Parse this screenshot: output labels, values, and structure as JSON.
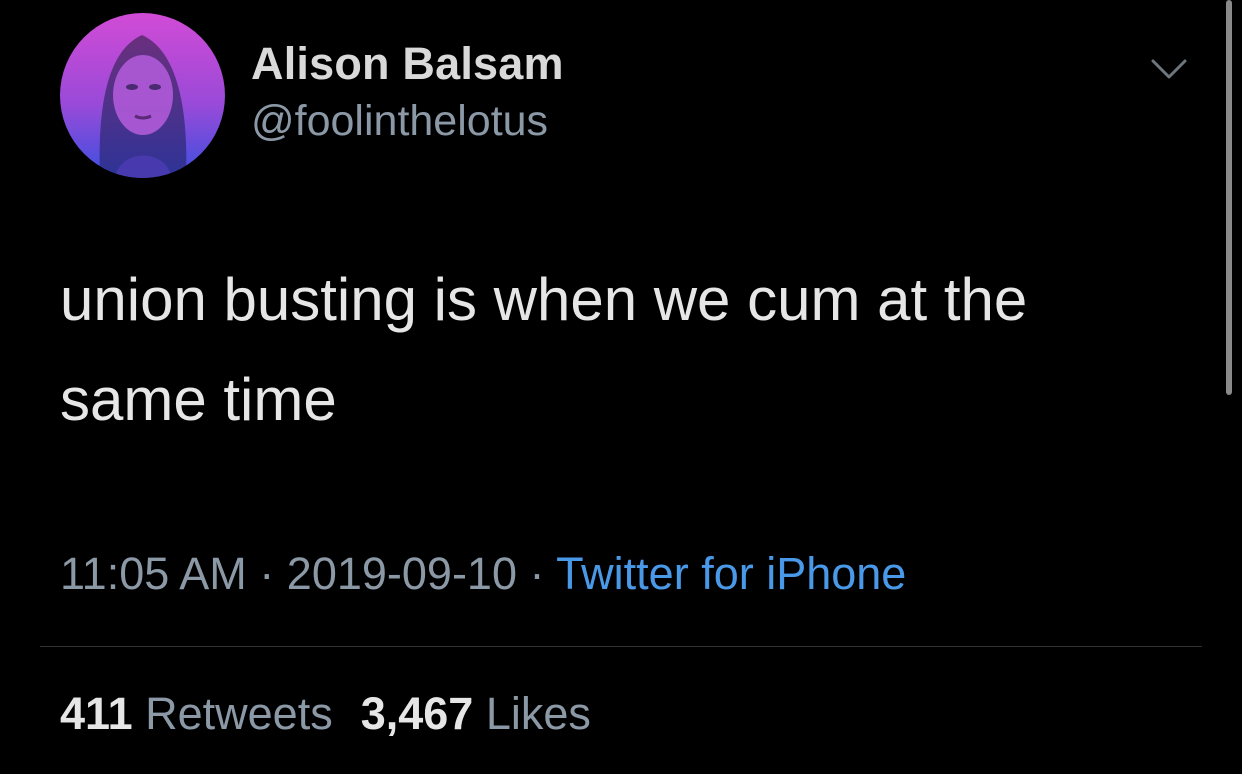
{
  "author": {
    "display_name": "Alison Balsam",
    "handle": "@foolinthelotus"
  },
  "tweet": {
    "text": "union busting is when we cum at the same time",
    "time": "11:05 AM",
    "separator": " · ",
    "date": "2019-09-10",
    "source": "Twitter for iPhone"
  },
  "stats": {
    "retweets_count": "411",
    "retweets_label": "Retweets",
    "likes_count": "3,467",
    "likes_label": "Likes"
  },
  "icons": {
    "menu": "chevron-down-icon"
  },
  "colors": {
    "background": "#000000",
    "text_primary": "#e6e6e6",
    "text_secondary": "#8b98a5",
    "link": "#4a99e9",
    "avatar_gradient_top": "#d14bd6",
    "avatar_gradient_bottom": "#3a4fe0"
  }
}
